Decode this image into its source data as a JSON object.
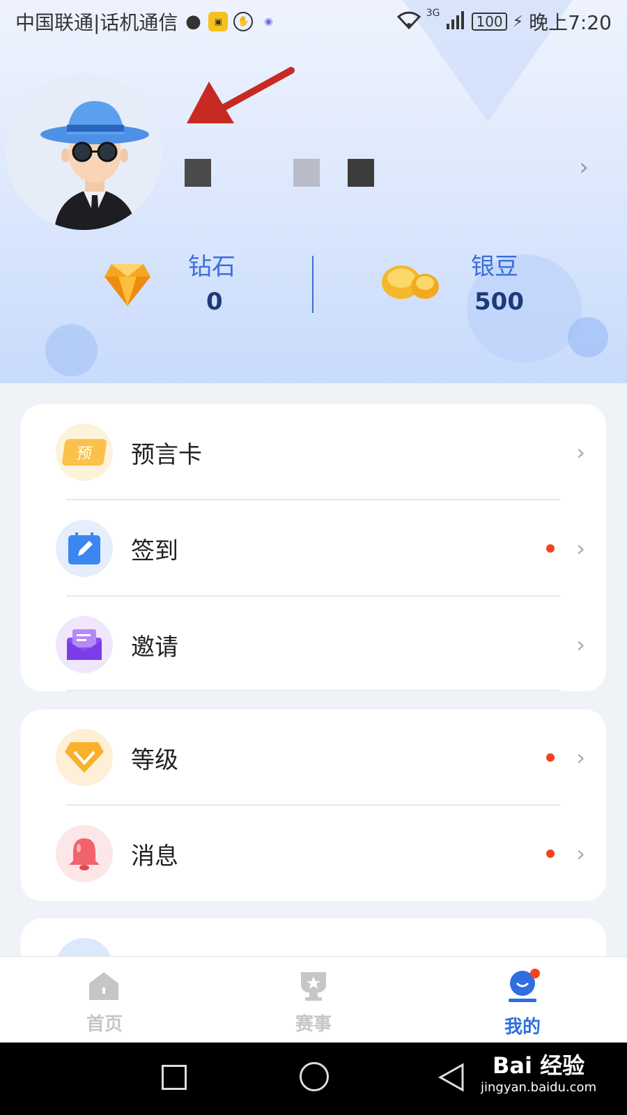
{
  "status_bar": {
    "carrier": "中国联通|话机通信",
    "network": "3G",
    "battery": "100",
    "time": "晚上7:20"
  },
  "profile": {
    "username": "",
    "avatar": "detective-avatar"
  },
  "stats": {
    "diamond": {
      "label": "钻石",
      "value": "0",
      "icon": "diamond-icon"
    },
    "silver_beans": {
      "label": "银豆",
      "value": "500",
      "icon": "bean-icon"
    }
  },
  "menu_group_1": [
    {
      "label": "预言卡",
      "icon": "prophecy-card-icon",
      "icon_text": "预",
      "dot": false
    },
    {
      "label": "签到",
      "icon": "checkin-icon",
      "dot": true
    },
    {
      "label": "邀请",
      "icon": "invite-icon",
      "dot": false
    }
  ],
  "menu_group_2": [
    {
      "label": "等级",
      "icon": "level-icon",
      "dot": true
    },
    {
      "label": "消息",
      "icon": "bell-icon",
      "dot": true
    }
  ],
  "tabs": [
    {
      "label": "首页",
      "icon": "home-icon",
      "active": false
    },
    {
      "label": "赛事",
      "icon": "trophy-icon",
      "active": false
    },
    {
      "label": "我的",
      "icon": "profile-icon",
      "active": true
    }
  ],
  "watermark": {
    "brand": "Bai 经验",
    "url": "jingyan.baidu.com"
  },
  "colors": {
    "accent": "#2f6de0",
    "badge": "#f0451f",
    "inactive_tab": "#c6c6c6"
  }
}
